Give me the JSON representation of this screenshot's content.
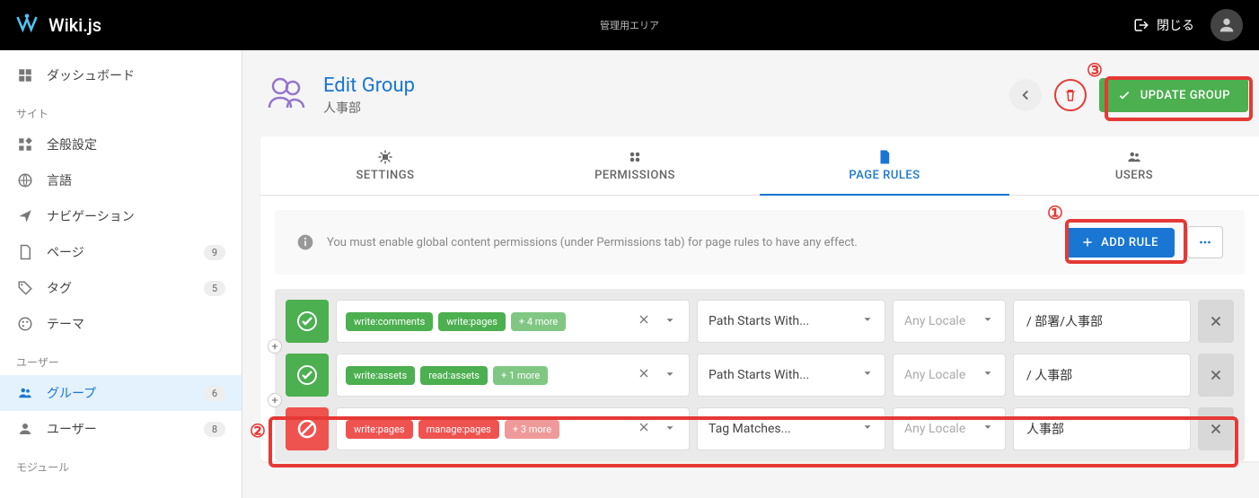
{
  "app": {
    "name": "Wiki.js",
    "admin_area": "管理用エリア",
    "close": "閉じる"
  },
  "sidebar": {
    "dashboard": "ダッシュボード",
    "section_site": "サイト",
    "general": "全般設定",
    "locale": "言語",
    "navigation": "ナビゲーション",
    "pages": "ページ",
    "pages_badge": "9",
    "tags": "タグ",
    "tags_badge": "5",
    "theme": "テーマ",
    "section_users": "ユーザー",
    "groups": "グループ",
    "groups_badge": "6",
    "users": "ユーザー",
    "users_badge": "8",
    "section_modules": "モジュール"
  },
  "page": {
    "title": "Edit Group",
    "subtitle": "人事部",
    "update": "UPDATE GROUP"
  },
  "tabs": {
    "settings": "SETTINGS",
    "permissions": "PERMISSIONS",
    "page_rules": "PAGE RULES",
    "users": "USERS"
  },
  "info": {
    "message": "You must enable global content permissions (under Permissions tab) for page rules to have any effect.",
    "add_rule": "ADD RULE"
  },
  "rules": [
    {
      "mode": "allow",
      "perms": [
        "write:comments",
        "write:pages"
      ],
      "more": "+ 4 more",
      "match": "Path Starts With...",
      "locale": "Any Locale",
      "path": "/ 部署/人事部"
    },
    {
      "mode": "allow",
      "perms": [
        "write:assets",
        "read:assets"
      ],
      "more": "+ 1 more",
      "match": "Path Starts With...",
      "locale": "Any Locale",
      "path": "/ 人事部"
    },
    {
      "mode": "deny",
      "perms": [
        "write:pages",
        "manage:pages"
      ],
      "more": "+ 3 more",
      "match": "Tag Matches...",
      "locale": "Any Locale",
      "path": "人事部"
    }
  ],
  "annotations": {
    "n1": "①",
    "n2": "②",
    "n3": "③"
  }
}
